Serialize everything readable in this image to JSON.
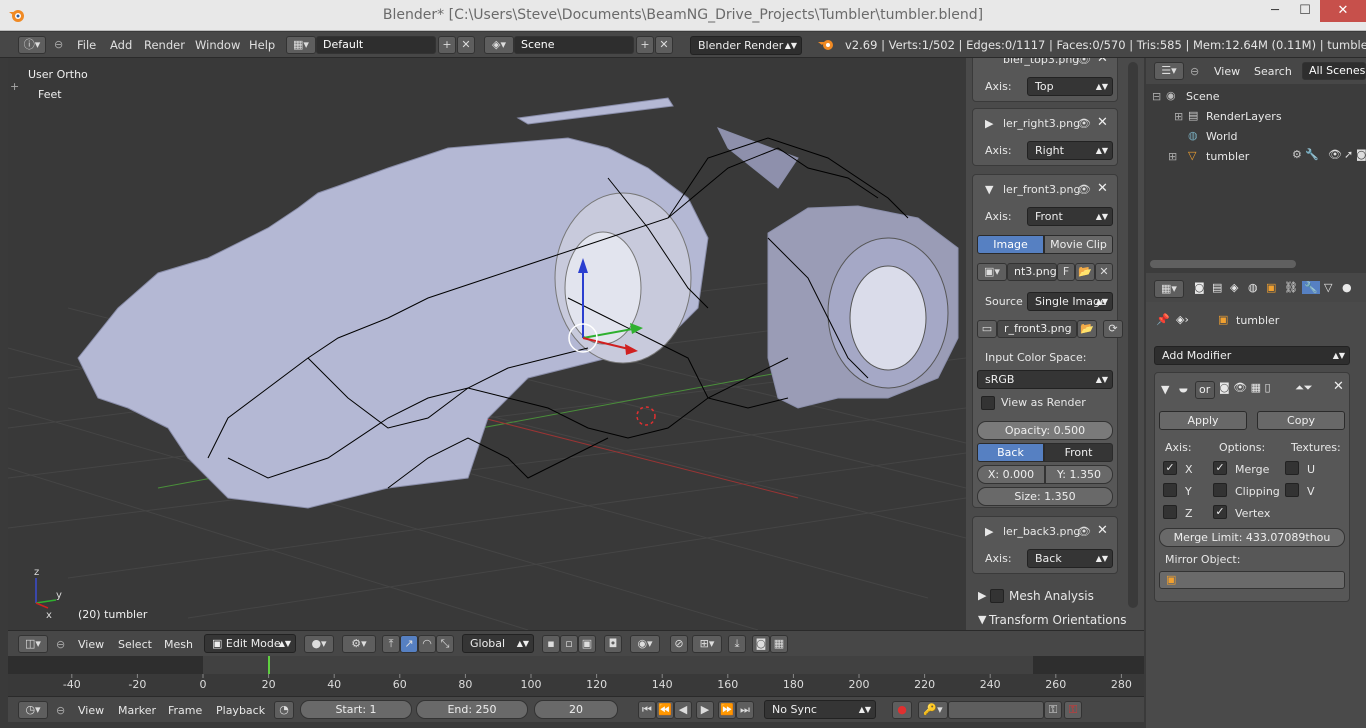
{
  "window": {
    "title": "Blender* [C:\\Users\\Steve\\Documents\\BeamNG_Drive_Projects\\Tumbler\\tumbler.blend]",
    "minimize": "─",
    "maximize": "☐",
    "close": "✕"
  },
  "menu": {
    "items": [
      "File",
      "Add",
      "Render",
      "Window",
      "Help"
    ],
    "screen_layout": "Default",
    "scene": "Scene",
    "render_engine": "Blender Render",
    "stats": "v2.69 | Verts:1/502 | Edges:0/1117 | Faces:0/570 | Tris:585 | Mem:12.64M (0.11M) | tumbler"
  },
  "viewport": {
    "view_name": "User Ortho",
    "units": "Feet",
    "object_info": "(20) tumbler",
    "axis_x": "x",
    "axis_y": "y",
    "axis_z": "z"
  },
  "npanel": {
    "bg_top": {
      "name": "bler_top3.png",
      "axis_label": "Axis:",
      "axis": "Top"
    },
    "bg_right": {
      "name": "ler_right3.png",
      "axis_label": "Axis:",
      "axis": "Right"
    },
    "bg_front": {
      "name": "ler_front3.png",
      "axis_label": "Axis:",
      "axis": "Front",
      "source_image": "Image",
      "source_clip": "Movie Clip",
      "image_field": "nt3.png",
      "image_f": "F",
      "source_label": "Source",
      "source_value": "Single Image",
      "file_field": "r_front3.png",
      "color_space_label": "Input Color Space:",
      "color_space": "sRGB",
      "view_as_render": "View as Render",
      "opacity": "Opacity: 0.500",
      "back": "Back",
      "front": "Front",
      "x_value": "X: 0.000",
      "y_value": "Y: 1.350",
      "size": "Size: 1.350"
    },
    "bg_back": {
      "name": "ler_back3.png",
      "axis_label": "Axis:",
      "axis": "Back"
    },
    "mesh_analysis": "Mesh Analysis",
    "transform_orientations": "Transform Orientations"
  },
  "outliner": {
    "view": "View",
    "search": "Search",
    "filter": "All Scenes",
    "items": [
      {
        "label": "Scene"
      },
      {
        "label": "RenderLayers"
      },
      {
        "label": "World"
      },
      {
        "label": "tumbler"
      }
    ]
  },
  "properties": {
    "object_name": "tumbler",
    "add_modifier": "Add Modifier",
    "modifier_name": "or",
    "apply": "Apply",
    "copy": "Copy",
    "axis_label": "Axis:",
    "options_label": "Options:",
    "textures_label": "Textures:",
    "x": "X",
    "y": "Y",
    "z": "Z",
    "merge": "Merge",
    "clipping": "Clipping",
    "vertex": "Vertex",
    "u": "U",
    "v": "V",
    "merge_limit": "Merge Limit: 433.07089thou",
    "mirror_object": "Mirror Object:",
    "checks": {
      "x": true,
      "y": false,
      "z": false,
      "merge": true,
      "clipping": false,
      "vertex": true,
      "u": false,
      "v": false
    }
  },
  "view3d_header": {
    "view": "View",
    "select": "Select",
    "mesh": "Mesh",
    "mode": "Edit Mode",
    "orientation": "Global"
  },
  "timeline": {
    "ticks": [
      "-40",
      "-20",
      "0",
      "20",
      "40",
      "60",
      "80",
      "100",
      "120",
      "140",
      "160",
      "180",
      "200",
      "220",
      "240",
      "260",
      "280"
    ],
    "current_frame_marker": 20
  },
  "footer": {
    "view": "View",
    "marker": "Marker",
    "frame": "Frame",
    "playback": "Playback",
    "start": "Start: 1",
    "end": "End: 250",
    "current": "20",
    "sync": "No Sync"
  },
  "colors": {
    "accent_blue": "#5680c2",
    "mesh_fill": "#b4b8d4",
    "wire": "#000000"
  }
}
